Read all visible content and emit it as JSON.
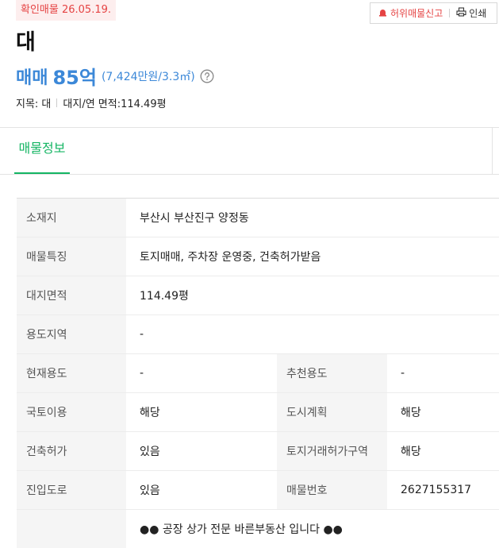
{
  "header": {
    "confirm_badge": "확인매물 26.05.19.",
    "report_label": "허위매물신고",
    "print_label": "인쇄",
    "title": "대",
    "price": {
      "type": "매매",
      "amount": "85억",
      "per_unit": "(7,424만원/3.3㎡)"
    },
    "summary": {
      "land_category": "지목: 대",
      "area": "대지/연 면적:114.49평"
    }
  },
  "tabs": [
    {
      "label": "매물정보",
      "active": true
    }
  ],
  "info": {
    "location": {
      "label": "소재지",
      "value": "부산시 부산진구 양정동"
    },
    "features": {
      "label": "매물특징",
      "value": "토지매매, 주차장 운영중, 건축허가받음"
    },
    "land_area": {
      "label": "대지면적",
      "value": "114.49평"
    },
    "zoning": {
      "label": "용도지역",
      "value": "-"
    },
    "current_use": {
      "label": "현재용도",
      "value": "-"
    },
    "recommended_use": {
      "label": "추천용도",
      "value": "-"
    },
    "land_use": {
      "label": "국토이용",
      "value": "해당"
    },
    "urban_plan": {
      "label": "도시계획",
      "value": "해당"
    },
    "building_permit": {
      "label": "건축허가",
      "value": "있음"
    },
    "land_trade_permit": {
      "label": "토지거래허가구역",
      "value": "해당"
    },
    "access_road": {
      "label": "진입도로",
      "value": "있음"
    },
    "listing_number": {
      "label": "매물번호",
      "value": "2627155317"
    },
    "description": "●● 공장 상가 전문 바른부동산 입니다 ●●"
  },
  "colors": {
    "accent_green": "#14b563",
    "price_blue": "#3c88d8",
    "alert_red": "#e54343"
  },
  "icons": [
    "siren-icon",
    "print-icon",
    "help-circle-icon"
  ]
}
